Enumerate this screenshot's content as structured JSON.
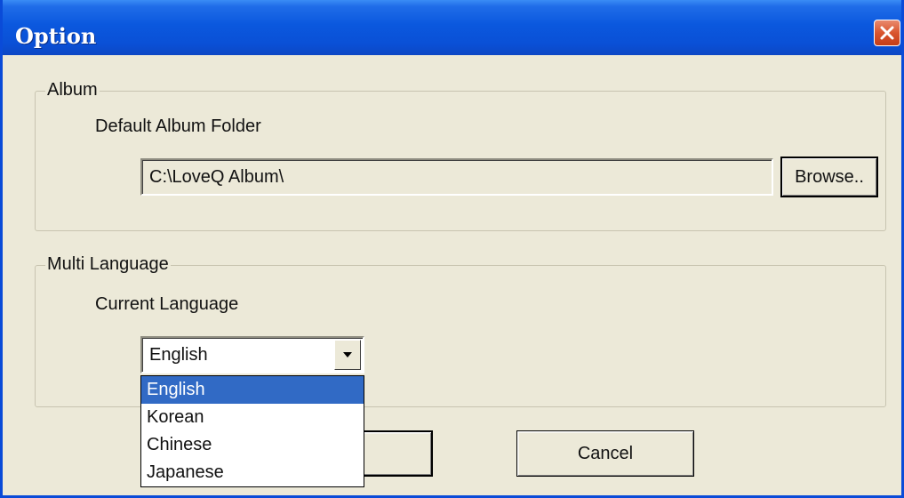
{
  "window": {
    "title": "Option",
    "accent_color": "#0A50D6"
  },
  "album": {
    "group_label": "Album",
    "folder_label": "Default Album Folder",
    "folder_value": "C:\\LoveQ Album\\",
    "browse_label": "Browse.."
  },
  "language": {
    "group_label": "Multi Language",
    "current_label": "Current Language",
    "selected": "English",
    "options": [
      "English",
      "Korean",
      "Chinese",
      "Japanese"
    ],
    "highlight_color": "#316AC5"
  },
  "buttons": {
    "cancel_label": "Cancel"
  }
}
